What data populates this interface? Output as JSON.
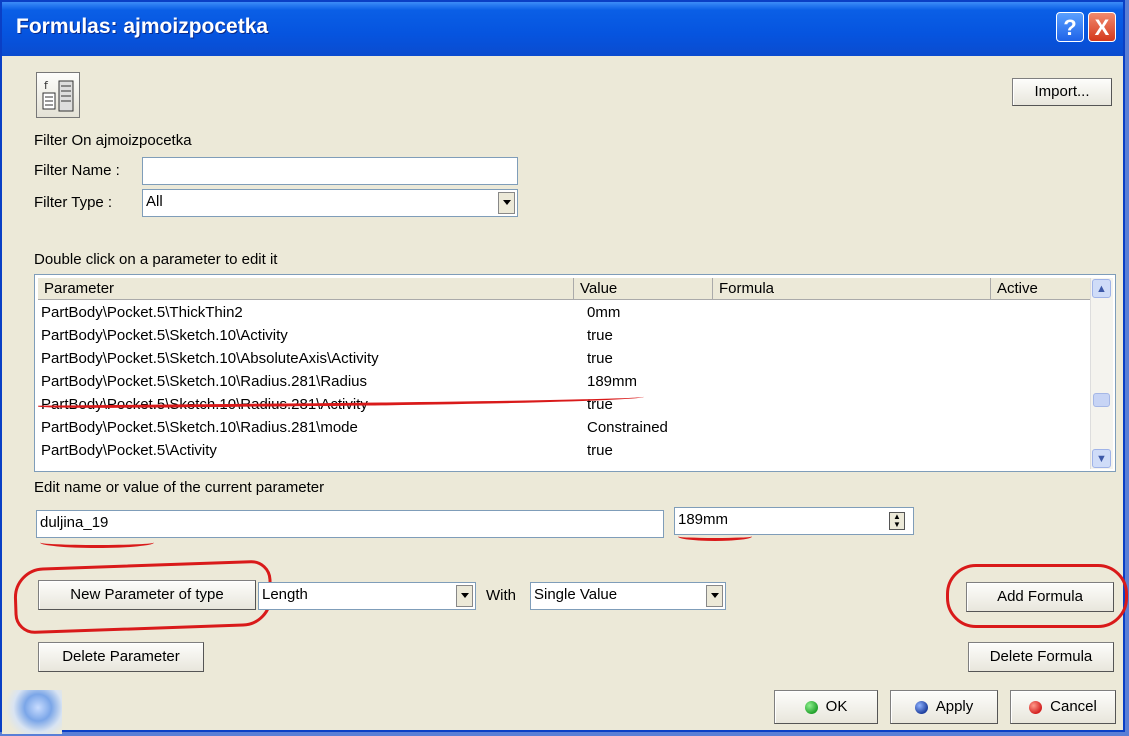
{
  "window": {
    "title": "Formulas: ajmoizpocetka",
    "help_glyph": "?",
    "close_glyph": "X"
  },
  "toolbar": {
    "import_label": "Import..."
  },
  "filter": {
    "heading": "Filter On ajmoizpocetka",
    "name_label": "Filter Name :",
    "name_value": "",
    "type_label": "Filter Type :",
    "type_value": "All"
  },
  "table": {
    "hint": "Double click on a parameter to edit it",
    "columns": [
      "Parameter",
      "Value",
      "Formula",
      "Active"
    ],
    "rows": [
      {
        "parameter": "PartBody\\Pocket.5\\ThickThin2",
        "value": "0mm"
      },
      {
        "parameter": "PartBody\\Pocket.5\\Sketch.10\\Activity",
        "value": "true"
      },
      {
        "parameter": "PartBody\\Pocket.5\\Sketch.10\\AbsoluteAxis\\Activity",
        "value": "true"
      },
      {
        "parameter": "PartBody\\Pocket.5\\Sketch.10\\Radius.281\\Radius",
        "value": "189mm"
      },
      {
        "parameter": "PartBody\\Pocket.5\\Sketch.10\\Radius.281\\Activity",
        "value": "true"
      },
      {
        "parameter": "PartBody\\Pocket.5\\Sketch.10\\Radius.281\\mode",
        "value": "Constrained"
      },
      {
        "parameter": "PartBody\\Pocket.5\\Activity",
        "value": "true"
      }
    ]
  },
  "edit": {
    "label": "Edit name or value of the current parameter",
    "name_value": "duljina_19",
    "value_value": "189mm"
  },
  "new_param": {
    "button_label": "New Parameter of type",
    "type_value": "Length",
    "with_label": "With",
    "with_value": "Single Value"
  },
  "buttons": {
    "add_formula": "Add Formula",
    "delete_parameter": "Delete Parameter",
    "delete_formula": "Delete Formula",
    "ok": "OK",
    "apply": "Apply",
    "cancel": "Cancel"
  },
  "colors": {
    "titlebar": "#0654df",
    "dialog_bg": "#ece9d8",
    "annotation": "#d91a1a",
    "ok_dot": "#22a12c",
    "apply_dot": "#1e3f9e",
    "cancel_dot": "#d32020"
  }
}
